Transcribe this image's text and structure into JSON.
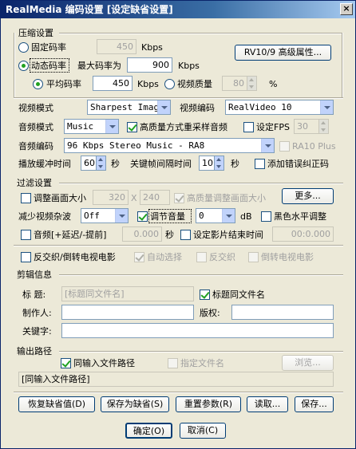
{
  "window": {
    "title": "RealMedia 编码设置 [设定缺省设置]",
    "close": "×"
  },
  "compress": {
    "title": "压缩设置",
    "fixed": "固定码率",
    "fixed_val": "450",
    "kbps": "Kbps",
    "dynamic": "动态码率",
    "max_label": "最大码率为",
    "max_val": "900",
    "kbps2": "Kbps",
    "avg": "平均码率",
    "avg_val": "450",
    "kbps3": "Kbps",
    "quality": "视频质量",
    "quality_val": "80",
    "pct": "%",
    "rv_btn": "RV10/9 高级属性..."
  },
  "video": {
    "mode_label": "视频模式",
    "mode_val": "Sharpest Image",
    "codec_label": "视频编码",
    "codec_val": "RealVideo 10",
    "audio_mode_label": "音频模式",
    "audio_mode_val": "Music",
    "hq_resample": "高质量方式重采样音频",
    "set_fps": "设定FPS",
    "fps_val": "30",
    "audio_codec_label": "音频编码",
    "audio_codec_val": "96 Kbps Stereo Music - RA8",
    "ra10": "RA10 Plus",
    "buffer_label": "播放缓冲时间",
    "buffer_val": "60",
    "sec1": "秒",
    "keyframe_label": "关键帧间隔时间",
    "keyframe_val": "10",
    "sec2": "秒",
    "err_correct": "添加错误纠正码"
  },
  "filter": {
    "title": "过滤设置",
    "resize": "调整画面大小",
    "w": "320",
    "x": "X",
    "h": "240",
    "hq_resize": "高质量调整画面大小",
    "more": "更多...",
    "noise_label": "减少视频杂波",
    "noise_val": "Off",
    "volume": "调节音量",
    "vol_val": "0",
    "db": "dB",
    "black": "黑色水平调整",
    "audio_delay": "音频[+延迟/-提前]",
    "delay_val": "0.000",
    "sec": "秒",
    "set_end": "设定影片结束时间",
    "end_val": "00:0.000"
  },
  "deint": {
    "items": [
      "反交织/倒转电视电影",
      "自动选择",
      "反交织",
      "倒转电视电影"
    ]
  },
  "clip": {
    "title": "剪辑信息",
    "title_label": "标    题:",
    "title_val": "[标题同文件名]",
    "same_as_file": "标题同文件名",
    "author": "制作人:",
    "copyright": "版权:",
    "keywords": "关键字:"
  },
  "output": {
    "title": "输出路径",
    "same_input": "同输入文件路径",
    "specify": "指定文件名",
    "browse": "浏览...",
    "path_val": "[同输入文件路径]"
  },
  "buttons": {
    "restore": "恢复缺省值(D)",
    "save_default": "保存为缺省(S)",
    "reset": "重置参数(R)",
    "load": "读取...",
    "save": "保存...",
    "ok": "确定(O)",
    "cancel": "取消(C)"
  }
}
